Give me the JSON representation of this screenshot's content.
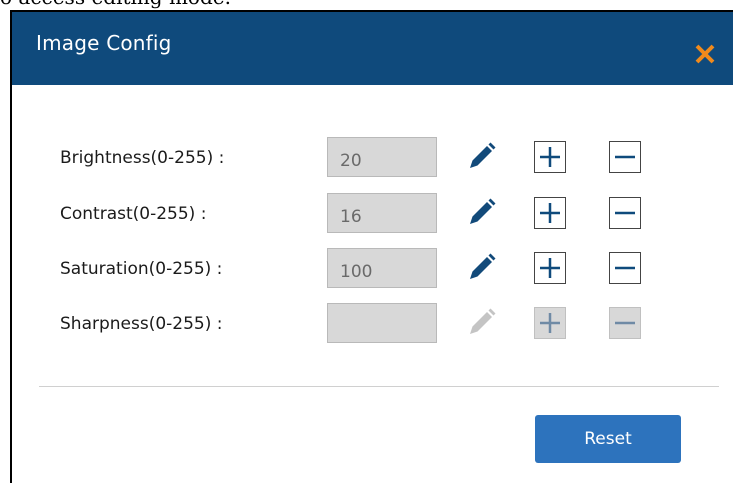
{
  "behind_text": "o access editing mode.",
  "dialog": {
    "title": "Image Config",
    "close_icon": "close-x-icon",
    "reset_label": "Reset"
  },
  "colors": {
    "header_bg": "#0f4a7c",
    "close_icon": "#f08a1c",
    "button_primary": "#2d73bd",
    "edit_icon_enabled": "#124a7a",
    "edit_icon_disabled": "#c4c4c4"
  },
  "settings": [
    {
      "label": "Brightness(0-255) :",
      "value": "20",
      "enabled": true,
      "icons": [
        "pencil-icon",
        "plus-icon",
        "minus-icon"
      ]
    },
    {
      "label": "Contrast(0-255) :",
      "value": "16",
      "enabled": true,
      "icons": [
        "pencil-icon",
        "plus-icon",
        "minus-icon"
      ]
    },
    {
      "label": "Saturation(0-255) :",
      "value": "100",
      "enabled": true,
      "icons": [
        "pencil-icon",
        "plus-icon",
        "minus-icon"
      ]
    },
    {
      "label": "Sharpness(0-255) :",
      "value": "",
      "enabled": false,
      "icons": [
        "pencil-icon",
        "plus-icon",
        "minus-icon"
      ]
    }
  ]
}
